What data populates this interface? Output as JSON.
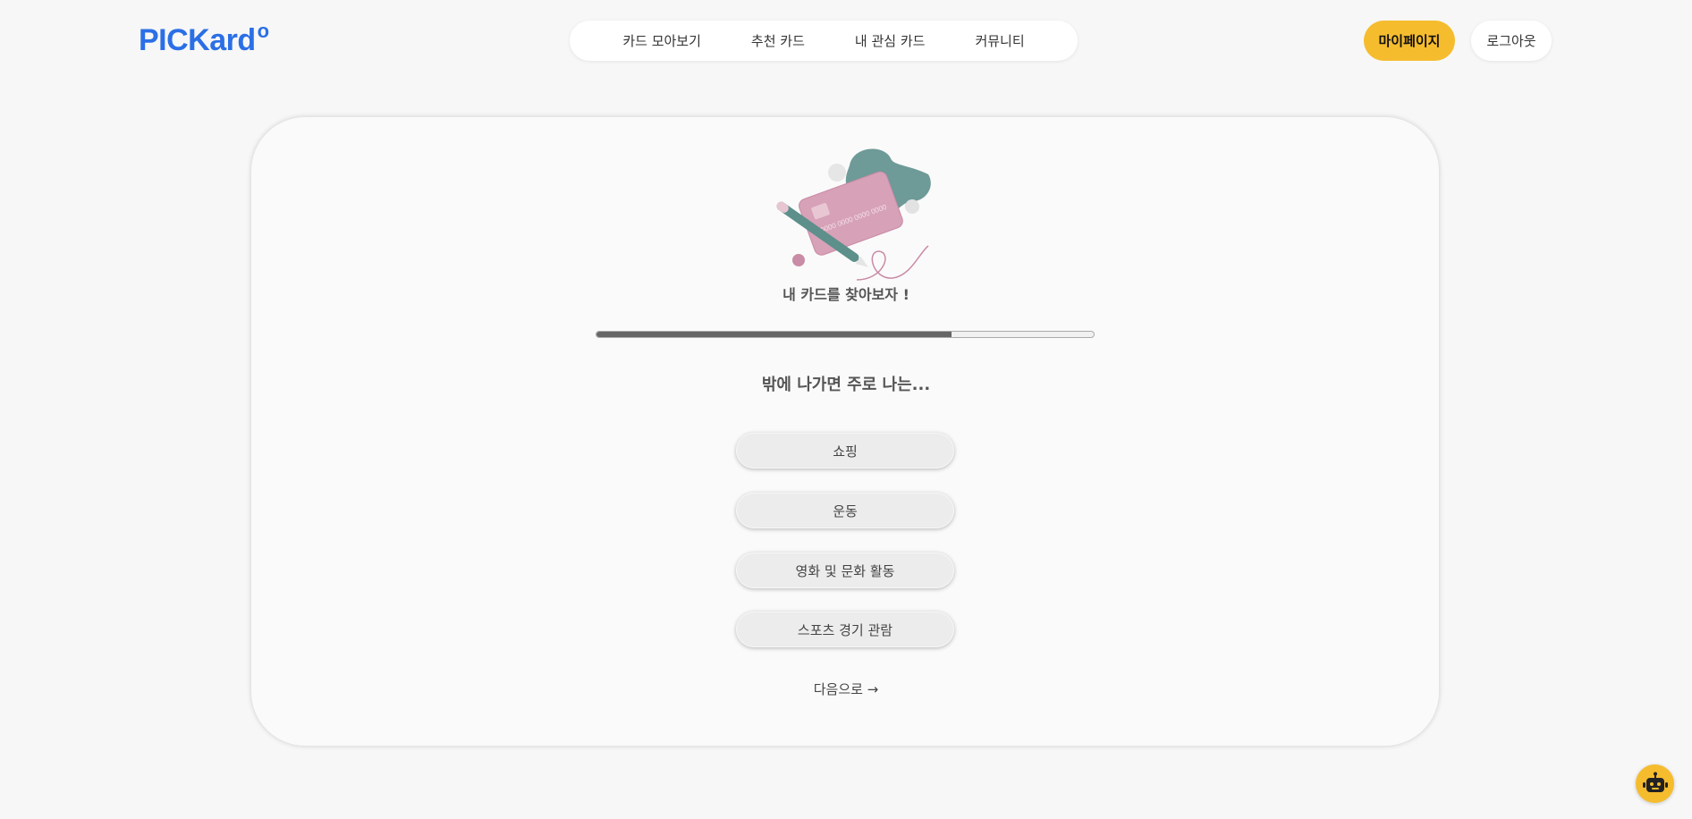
{
  "header": {
    "logo": "PICKard",
    "logo_mark": "o",
    "nav": [
      "카드 모아보기",
      "추천 카드",
      "내 관심 카드",
      "커뮤니티"
    ],
    "mypage_label": "마이페이지",
    "logout_label": "로그아웃"
  },
  "quiz": {
    "title": "내 카드를 찾아보자 !",
    "progress": 0.714,
    "question": "밖에 나가면 주로 나는...",
    "options": [
      "쇼핑",
      "운동",
      "영화 및 문화 활동",
      "스포츠 경기 관람"
    ],
    "next_label": "다음으로 →",
    "illustration_text": "0000 0000 0000 0000"
  },
  "colors": {
    "brand": "#2b6fe6",
    "accent": "#f5bc2e",
    "progress_fill": "#666666"
  },
  "icons": {
    "chatbot": "robot-icon"
  }
}
